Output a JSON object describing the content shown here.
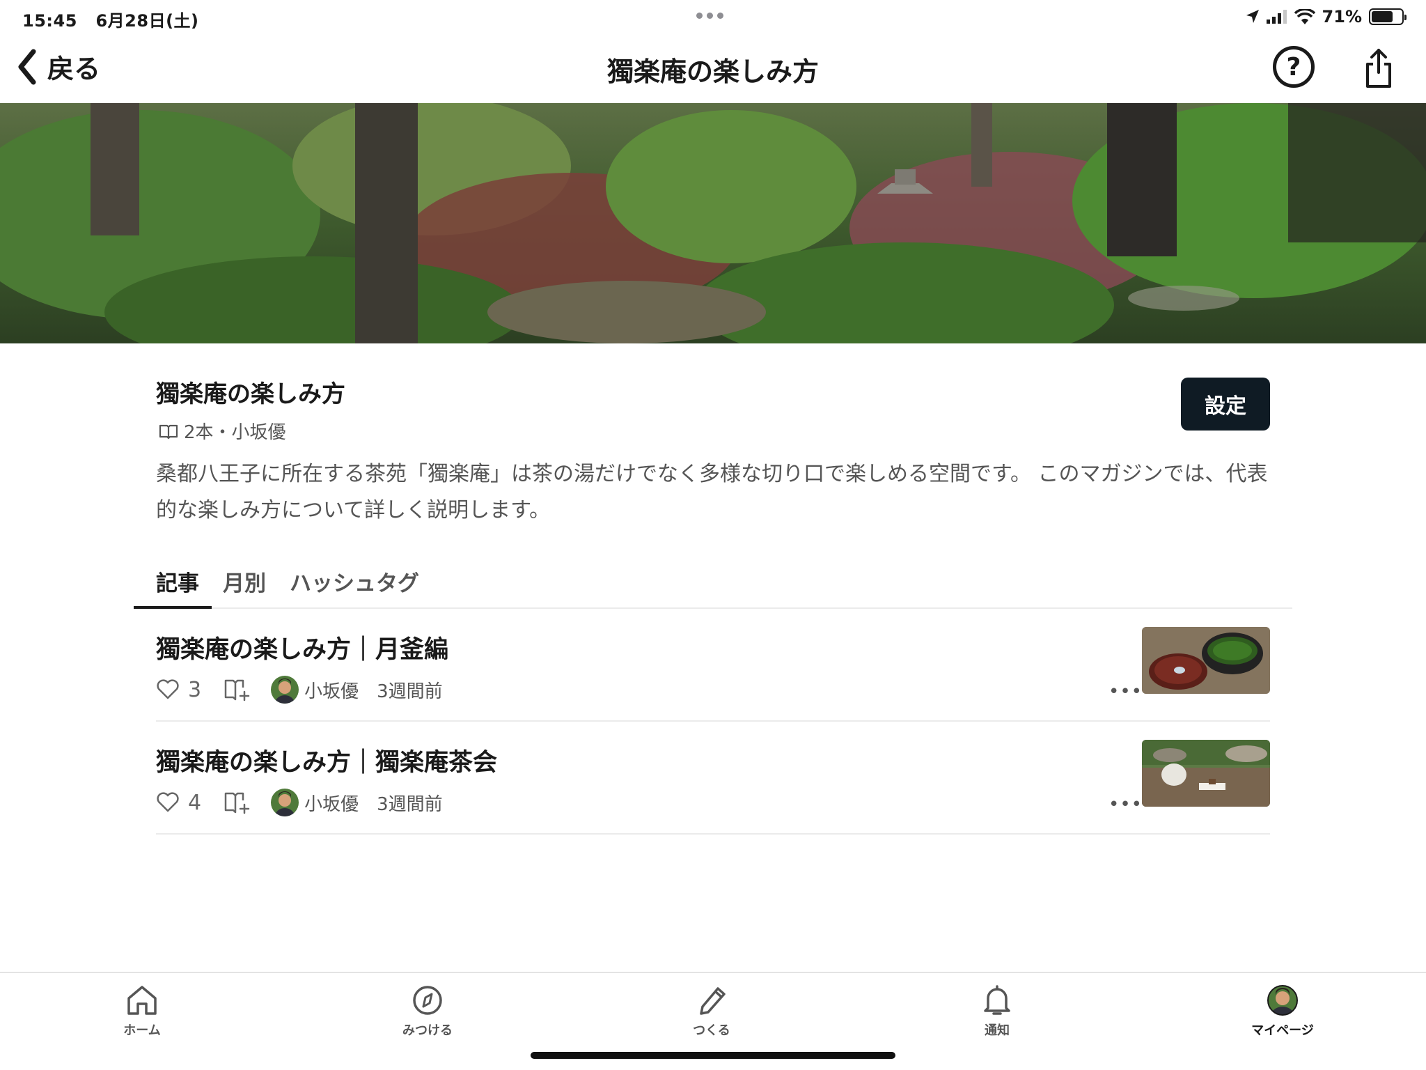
{
  "status_bar": {
    "time": "15:45",
    "date": "6月28日(土)",
    "battery": "71%",
    "battery_level": 0.71
  },
  "nav": {
    "back_label": "戻る",
    "title": "獨楽庵の楽しみ方",
    "help_label": "?"
  },
  "magazine": {
    "title": "獨楽庵の楽しみ方",
    "meta": "2本・小坂優",
    "settings_label": "設定",
    "description": "桑都八王子に所在する茶苑「獨楽庵」は茶の湯だけでなく多様な切り口で楽しめる空間です。 このマガジンでは、代表的な楽しみ方について詳しく説明します。"
  },
  "tabs": [
    {
      "label": "記事",
      "active": true
    },
    {
      "label": "月別",
      "active": false
    },
    {
      "label": "ハッシュタグ",
      "active": false
    }
  ],
  "articles": [
    {
      "title": "獨楽庵の楽しみ方｜月釜編",
      "likes": "3",
      "author": "小坂優",
      "time": "3週間前",
      "more": "•••"
    },
    {
      "title": "獨楽庵の楽しみ方｜獨楽庵茶会",
      "likes": "4",
      "author": "小坂優",
      "time": "3週間前",
      "more": "•••"
    }
  ],
  "tabbar": [
    {
      "label": "ホーム",
      "icon": "home-icon"
    },
    {
      "label": "みつける",
      "icon": "compass-icon"
    },
    {
      "label": "つくる",
      "icon": "pencil-icon"
    },
    {
      "label": "通知",
      "icon": "bell-icon"
    },
    {
      "label": "マイページ",
      "icon": "avatar-icon"
    }
  ],
  "colors": {
    "settings_button_bg": "#0f1b24",
    "text_primary": "#1a1a1a",
    "text_secondary": "#555555"
  }
}
